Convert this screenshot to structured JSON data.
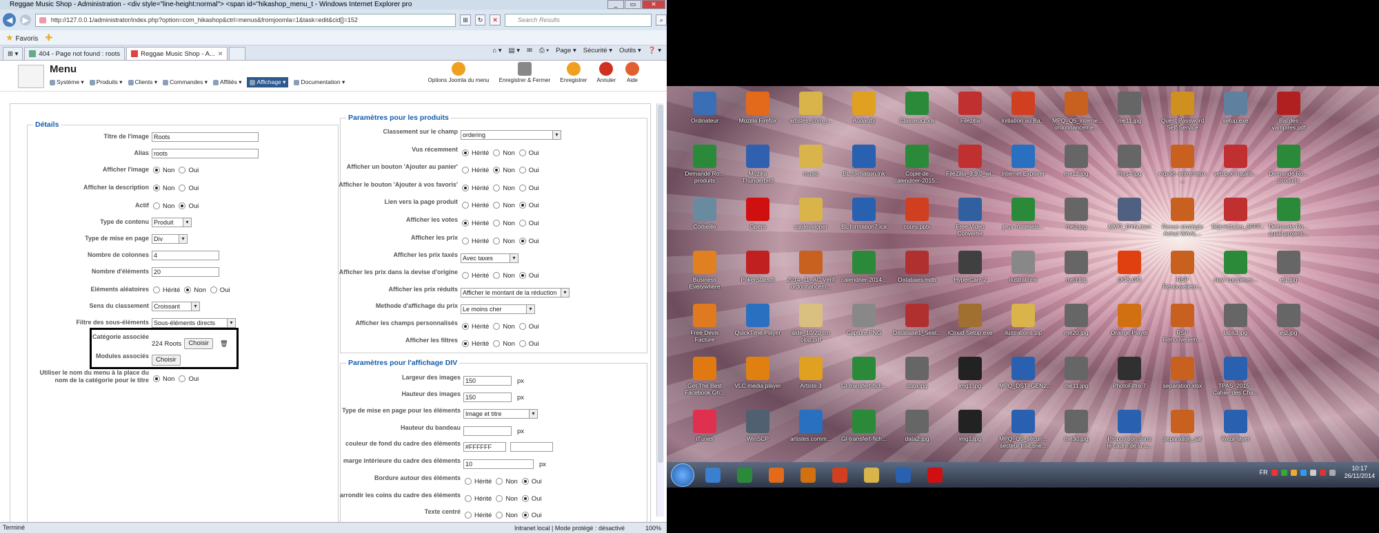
{
  "browser": {
    "title": "Reggae Music Shop - Administration - <div style=\"line-height:normal\"> <span id=\"hikashop_menu_t - Windows Internet Explorer pro",
    "url": "http://127.0.0.1/administrator/index.php?option=com_hikashop&ctrl=menus&fromjoomla=1&task=edit&cid[]=152",
    "search_placeholder": "Search Results",
    "favorites": "Favoris",
    "tabs": [
      "404 - Page not found : roots",
      "Reggae Music Shop - A..."
    ],
    "cmd": [
      "Page ▾",
      "Sécurité ▾",
      "Outils ▾"
    ],
    "status_left": "Terminé",
    "status_zone": "Intranet local | Mode protégé : désactivé",
    "zoom": "100%"
  },
  "joomla": {
    "title": "Menu",
    "nav": [
      "Système ▾",
      "Produits ▾",
      "Clients ▾",
      "Commandes ▾",
      "Affiliés ▾",
      "Affichage ▾",
      "Documentation ▾"
    ],
    "tools": [
      "Options Joomla du menu",
      "Enregistrer & Fermer",
      "Enregistrer",
      "Annuler",
      "Aide"
    ]
  },
  "details": {
    "legend": "Détails",
    "titre_lbl": "Titre de l'image",
    "titre_val": "Roots",
    "alias_lbl": "Alias",
    "alias_val": "roots",
    "affimg_lbl": "Afficher l'image",
    "affdesc_lbl": "Afficher la description",
    "actif_lbl": "Actif",
    "typec_lbl": "Type de contenu",
    "typec_val": "Produit",
    "typem_lbl": "Type de mise en page",
    "typem_val": "Div",
    "ncol_lbl": "Nombre de colonnes",
    "ncol_val": "4",
    "nel_lbl": "Nombre d'éléments",
    "nel_val": "20",
    "alea_lbl": "Eléments aléatoires",
    "sens_lbl": "Sens du classement",
    "sens_val": "Croissant",
    "filtre_lbl": "Filtre des sous-éléments",
    "filtre_val": "Sous-éléments directs",
    "cat_lbl": "Catégorie associée",
    "cat_val": "224 Roots",
    "mod_lbl": "Modules associés",
    "util_lbl": "Utiliser le nom du menu à la place du nom de la catégorie pour le titre",
    "choisir": "Choisir",
    "herite": "Hérité",
    "non": "Non",
    "oui": "Oui"
  },
  "prod": {
    "legend": "Paramètres pour les produits",
    "rows": [
      {
        "label": "Classement sur le champ",
        "type": "select",
        "value": "ordering"
      },
      {
        "label": "Vus récemment",
        "type": "radio",
        "checked": 0
      },
      {
        "label": "Afficher un bouton 'Ajouter au panier'",
        "type": "radio",
        "checked": 1
      },
      {
        "label": "Afficher le bouton 'Ajouter à vos favoris'",
        "type": "radio",
        "checked": 0
      },
      {
        "label": "Lien vers la page produit",
        "type": "radio",
        "checked": 2
      },
      {
        "label": "Afficher les votes",
        "type": "radio",
        "checked": 0
      },
      {
        "label": "Afficher les prix",
        "type": "radio",
        "checked": 2
      },
      {
        "label": "Afficher les prix taxés",
        "type": "select",
        "value": "Avec taxes"
      },
      {
        "label": "Afficher les prix dans la devise d'origine",
        "type": "radio",
        "checked": 2
      },
      {
        "label": "Afficher les prix réduits",
        "type": "select",
        "value": "Afficher le montant de la réduction"
      },
      {
        "label": "Methode d'affichage du prix",
        "type": "select",
        "value": "Le moins cher"
      },
      {
        "label": "Afficher les champs personnalisés",
        "type": "radio",
        "checked": 0
      },
      {
        "label": "Afficher les filtres",
        "type": "radio",
        "checked": 0
      }
    ]
  },
  "div": {
    "legend": "Paramètres pour l'affichage DIV",
    "rows": [
      {
        "label": "Largeur des images",
        "type": "text",
        "value": "150",
        "unit": "px"
      },
      {
        "label": "Hauteur des images",
        "type": "text",
        "value": "150",
        "unit": "px"
      },
      {
        "label": "Type de mise en page pour les éléments",
        "type": "select",
        "value": "Image et titre"
      },
      {
        "label": "Hauteur du bandeau",
        "type": "text",
        "value": "",
        "unit": "px"
      },
      {
        "label": "couleur de fond du cadre des éléments",
        "type": "color",
        "value": "#FFFFFF"
      },
      {
        "label": "marge intérieure du cadre des éléments",
        "type": "text",
        "value": "10",
        "unit": "px"
      },
      {
        "label": "Bordure autour des éléments",
        "type": "radio",
        "checked": 2
      },
      {
        "label": "arrondir les coins du cadre des éléments",
        "type": "radio",
        "checked": 2
      },
      {
        "label": "Texte centré",
        "type": "radio",
        "checked": 2
      }
    ]
  },
  "desktop": {
    "icons": [
      [
        "Ordinateur",
        "#3a6fb5"
      ],
      [
        "Mozilla Firefox",
        "#e36a1a"
      ],
      [
        "artistes_com_l...",
        "#d9b44a"
      ],
      [
        "Audacity",
        "#e0a020"
      ],
      [
        "Classeur1.xls",
        "#2b8a3a"
      ],
      [
        "Filezilla",
        "#c03030"
      ],
      [
        "Initiation au Ba...",
        "#d04020"
      ],
      [
        "MPQ_Q5_interne... ordonnanceme...",
        "#c86020"
      ],
      [
        "me11.jpg",
        "#666"
      ],
      [
        "Quest Password Self-Service",
        "#d09020"
      ],
      [
        "setup.exe",
        "#6080a0"
      ],
      [
        "Bal des vampires.pdf",
        "#b02020"
      ],
      [
        "Demande Ro... produits",
        "#2b8a3a"
      ],
      [
        "Mozilla Thunderbird",
        "#3060b0"
      ],
      [
        "music",
        "#d9b44a"
      ],
      [
        "BL formation.lnk",
        "#2a60b0"
      ],
      [
        "Copie de calendrier-2015...",
        "#2b8a3a"
      ],
      [
        "FileZilla_3.9.0_wi...",
        "#c03030"
      ],
      [
        "Internet Explorer",
        "#2a70c0"
      ],
      [
        "me12.jpg",
        "#666"
      ],
      [
        "me14.jpg",
        "#666"
      ],
      [
        "export-  entre deux ...",
        "#c86020"
      ],
      [
        "setup-x-installs...",
        "#c03030"
      ],
      [
        "Demande Ro... produits",
        "#2b8a3a"
      ],
      [
        "Corbeille",
        "#6a8aa0"
      ],
      [
        "Opera",
        "#d01010"
      ],
      [
        "sqldeveloper",
        "#d9b44a"
      ],
      [
        "BL formation7.ica",
        "#2a60b0"
      ],
      [
        "cours.pptx",
        "#d04020"
      ],
      [
        "Free Video Converter",
        "#3060a0"
      ],
      [
        "jeux materiels...",
        "#2b8a3a"
      ],
      [
        "me2.jpg",
        "#666"
      ],
      [
        "MMG_DYN.mmi",
        "#506080"
      ],
      [
        "Revue stratégie Achat WAAL...",
        "#c86020"
      ],
      [
        "SQLinstaller_3FFF...",
        "#c03030"
      ],
      [
        "Demande Ro... qualif projenc...",
        "#2b8a3a"
      ],
      [
        "Business Everywhere",
        "#e08020"
      ],
      [
        "PokerStars.fr",
        "#c02020"
      ],
      [
        "2014_11_AC Vérif ordonnancem...",
        "#c86020"
      ],
      [
        "calendrier-2014...",
        "#2b8a3a"
      ],
      [
        "Databaes.mdb",
        "#b03030"
      ],
      [
        "HyperCam 2",
        "#404040"
      ],
      [
        "ilustrations",
        "#888"
      ],
      [
        "me3.jpg",
        "#666"
      ],
      [
        "OCS GO",
        "#e04010"
      ],
      [
        "RSP Renouvellem...",
        "#c86020"
      ],
      [
        "suivi competen...",
        "#2b8a3a"
      ],
      [
        "ej1.jpg",
        "#666"
      ],
      [
        "Free Devis Facture",
        "#e07a20"
      ],
      [
        "QuickTime Player",
        "#2a70c0"
      ],
      [
        "aide_10/20 cm clop.pdf",
        "#d9c080"
      ],
      [
        "Capture.PNG",
        "#888"
      ],
      [
        "Database1_Seat...",
        "#b03030"
      ],
      [
        "iCloud Setup.exe",
        "#a07030"
      ],
      [
        "ilustrations.zip",
        "#d9b44a"
      ],
      [
        "me20.jpg",
        "#666"
      ],
      [
        "Orange Player",
        "#d07010"
      ],
      [
        "RSP Renouvellem...",
        "#c86020"
      ],
      [
        "tabs3.jpg",
        "#666"
      ],
      [
        "ej2.jpg",
        "#666"
      ],
      [
        "Get The Best Facebook Gh...",
        "#e07a10"
      ],
      [
        "VLC media player",
        "#e08010"
      ],
      [
        "Artiste 3",
        "#e0a020"
      ],
      [
        "GI-transfert-fich...",
        "#2b8a3a"
      ],
      [
        "data.jpg",
        "#666"
      ],
      [
        "img1.jpg",
        "#222"
      ],
      [
        "MPQ_DST_GEN2...",
        "#2a60b0"
      ],
      [
        "me11.jpg",
        "#666"
      ],
      [
        "PhotoFiltre 7",
        "#303030"
      ],
      [
        "separation.xlsx",
        "#c86020"
      ],
      [
        "TPAS_2015 - Cahier des Cha...",
        "#2a60b0"
      ],
      [
        "",
        "transparent"
      ],
      [
        "iTunes",
        "#e03050"
      ],
      [
        "WinSCP",
        "#506070"
      ],
      [
        "artistes.comm...",
        "#2a70c0"
      ],
      [
        "GI-transfert-fich...",
        "#2b8a3a"
      ],
      [
        "data2.jpg",
        "#666"
      ],
      [
        "img1.jpg",
        "#222"
      ],
      [
        "MPQ_Q5_sécuri... secteur trait.sne...",
        "#2a60b0"
      ],
      [
        "me30.jpg",
        "#666"
      ],
      [
        "Proposition dans le cadre de la s...",
        "#2a60b0"
      ],
      [
        "separation_sal",
        "#c86020"
      ],
      [
        "WebPlayer",
        "#2a60b0"
      ],
      [
        "",
        "transparent"
      ]
    ],
    "taskbar_apps": [
      "#3a80d0",
      "#2b8a3a",
      "#e36a1a",
      "#d07010",
      "#d04020",
      "#d9b44a",
      "#2a60b0",
      "#d01010"
    ],
    "tray_lang": "FR",
    "time": "10:17",
    "date": "26/11/2014"
  }
}
